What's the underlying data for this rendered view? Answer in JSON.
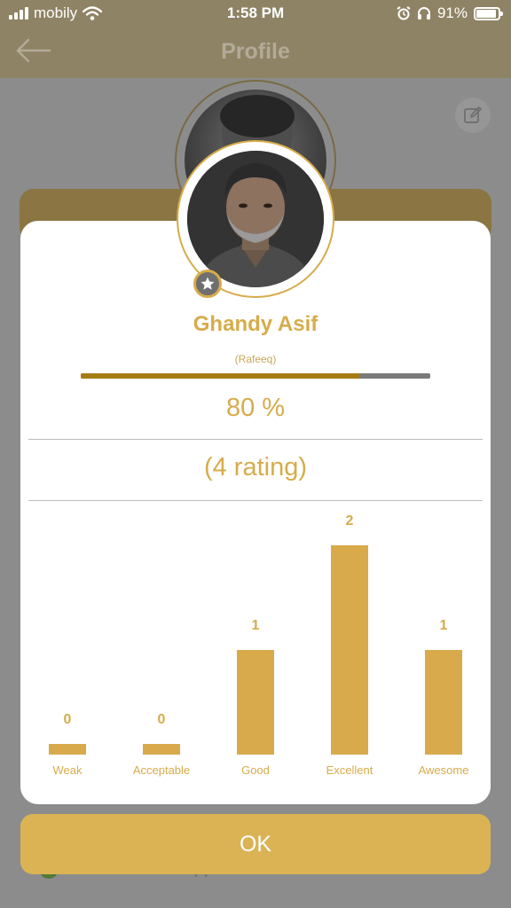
{
  "status_bar": {
    "carrier": "mobily",
    "time": "1:58 PM",
    "battery": "91%",
    "battery_level": 0.91,
    "icons": [
      "signal-icon",
      "wifi-icon",
      "alarm-icon",
      "headphones-icon",
      "battery-icon"
    ]
  },
  "nav": {
    "title": "Profile",
    "back_icon": "back-arrow-icon"
  },
  "background": {
    "edit_icon": "edit-icon",
    "terms_text": "All terms are approved"
  },
  "profile": {
    "name": "Ghandy Asif",
    "subtitle": "(Rafeeq)",
    "progress": 0.8,
    "percent_text": "80 %",
    "rating_count_text": "(4 rating)",
    "badge_icon": "star-icon"
  },
  "chart_data": {
    "type": "bar",
    "categories": [
      "Weak",
      "Acceptable",
      "Good",
      "Excellent",
      "Awesome"
    ],
    "values": [
      0,
      0,
      1,
      2,
      1
    ],
    "ylim": [
      0,
      2
    ],
    "color": "#d9aa4b"
  },
  "ok_button": {
    "label": "OK"
  },
  "colors": {
    "accent": "#d6ac4b",
    "progress_fill": "#a67c14",
    "progress_track": "#7a7a7a",
    "overlay": "#8c8c8c"
  }
}
